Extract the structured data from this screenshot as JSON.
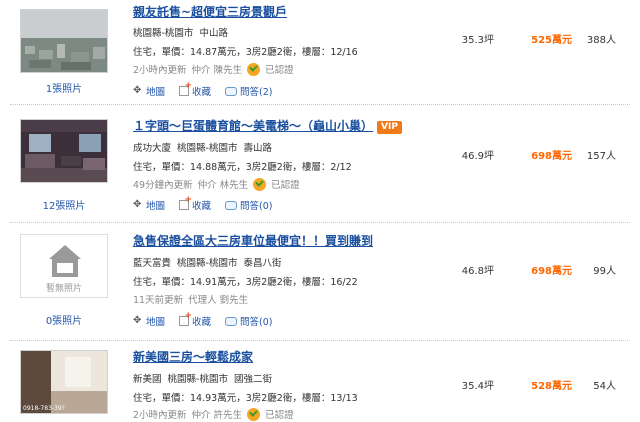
{
  "listings": [
    {
      "title": "親友託售~超便宜三房景觀戶",
      "vip": "",
      "community": "",
      "location": "桃園縣-桃園市",
      "road": "中山路",
      "info": "住宅，單價：14.87萬元，3房2廳2衛，樓層：12/16",
      "updated": "2小時內更新",
      "agent": "仲介 陳先生",
      "certified": "已認證",
      "photo_count": "1張照片",
      "thumb": "photo-aerial-icon",
      "area": "35.3坪",
      "price": "525萬元",
      "views": "388人",
      "actions": {
        "map": "地圖",
        "fav": "收藏",
        "qa": "問答(2)"
      }
    },
    {
      "title": "１字頭～巨蛋體育館～美電梯～（龜山小巢）",
      "vip": "VIP",
      "community": "成功大廈",
      "location": "桃園縣-桃園市",
      "road": "壽山路",
      "info": "住宅，單價：14.88萬元，3房2廳2衛，樓層：2/12",
      "updated": "49分鐘內更新",
      "agent": "仲介 林先生",
      "certified": "已認證",
      "photo_count": "12張照片",
      "thumb": "photo-interior-icon",
      "area": "46.9坪",
      "price": "698萬元",
      "views": "157人",
      "actions": {
        "map": "地圖",
        "fav": "收藏",
        "qa": "問答(0)"
      }
    },
    {
      "title": "急售保證全區大三房車位最便宜！！買到賺到",
      "vip": "",
      "community": "藍天富貴",
      "location": "桃園縣-桃園市",
      "road": "泰昌八街",
      "info": "住宅，單價：14.91萬元，3房2廳2衛，樓層：16/22",
      "updated": "11天前更新",
      "agent": "代理人 劉先生",
      "certified": "",
      "photo_count": "0張照片",
      "thumb": "no-photo-icon",
      "no_photo_label": "暫無照片",
      "area": "46.8坪",
      "price": "698萬元",
      "views": "99人",
      "actions": {
        "map": "地圖",
        "fav": "收藏",
        "qa": "問答(0)"
      }
    },
    {
      "title": "新美國三房～輕鬆成家",
      "vip": "",
      "community": "新美國",
      "location": "桃園縣-桃園市",
      "road": "國強二街",
      "info": "住宅，單價：14.93萬元，3房2廳2衛，樓層：13/13",
      "updated": "2小時內更新",
      "agent": "仲介 許先生",
      "certified": "已認證",
      "photo_count": "",
      "thumb": "photo-room-icon",
      "thumb_phone": "0918-783-39?",
      "area": "35.4坪",
      "price": "528萬元",
      "views": "54人",
      "actions": {
        "map": "",
        "fav": "",
        "qa": ""
      }
    }
  ],
  "colors": {
    "title": "#1a4fa0",
    "price": "#ff6600",
    "vip": "#f07a1a",
    "link": "#2255aa"
  }
}
